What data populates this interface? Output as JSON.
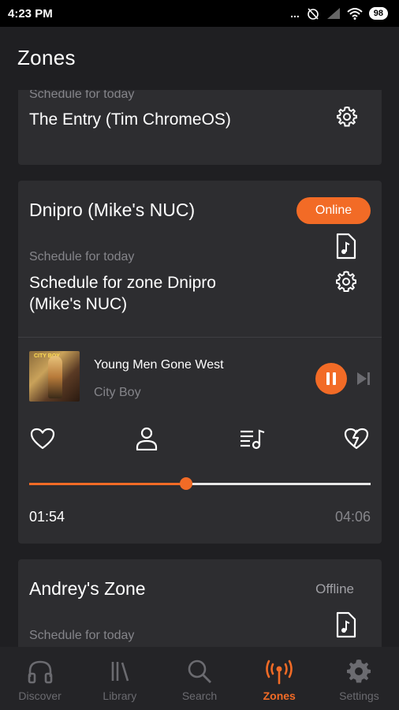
{
  "status_bar": {
    "time": "4:23 PM",
    "signal_dots": "...",
    "battery": "98"
  },
  "header": {
    "title": "Zones"
  },
  "zones": [
    {
      "schedule_label": "Schedule for today",
      "schedule_name": "The Entry (Tim ChromeOS)"
    },
    {
      "name": "Dnipro (Mike's NUC)",
      "status": "Online",
      "schedule_label": "Schedule for today",
      "schedule_name_line1": "Schedule for zone Dnipro",
      "schedule_name_line2": "(Mike's NUC)",
      "now_playing": {
        "title": "Young Men Gone West",
        "artist": "City Boy",
        "album_text": "CITY BOY",
        "elapsed": "01:54",
        "duration": "04:06",
        "progress": 0.46
      }
    },
    {
      "name": "Andrey's Zone",
      "status": "Offline",
      "schedule_label": "Schedule for today"
    }
  ],
  "bottom_nav": [
    {
      "label": "Discover",
      "icon": "headphones-icon",
      "active": false
    },
    {
      "label": "Library",
      "icon": "library-icon",
      "active": false
    },
    {
      "label": "Search",
      "icon": "search-icon",
      "active": false
    },
    {
      "label": "Zones",
      "icon": "broadcast-icon",
      "active": true
    },
    {
      "label": "Settings",
      "icon": "gear-icon",
      "active": false
    }
  ],
  "colors": {
    "accent": "#f26b26",
    "background": "#1f1f22",
    "card": "#2d2d30",
    "muted": "#85858a"
  }
}
